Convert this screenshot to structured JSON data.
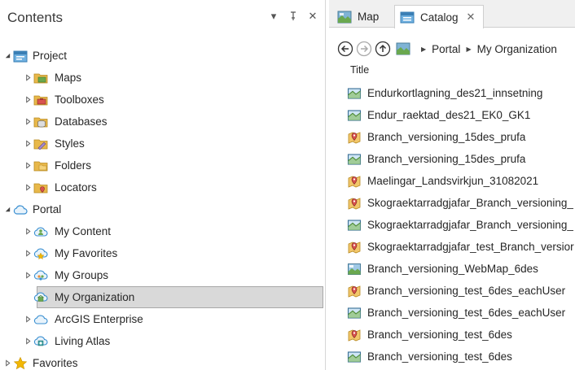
{
  "contents": {
    "title": "Contents",
    "controls": {
      "dropdown": "▾",
      "pin": "⊥",
      "close": "✕"
    },
    "tree": [
      {
        "label": "Project",
        "level": 0,
        "expanded": true,
        "icon": "project-icon"
      },
      {
        "label": "Maps",
        "level": 1,
        "expanded": false,
        "icon": "maps-folder-icon"
      },
      {
        "label": "Toolboxes",
        "level": 1,
        "expanded": false,
        "icon": "toolboxes-folder-icon"
      },
      {
        "label": "Databases",
        "level": 1,
        "expanded": false,
        "icon": "databases-folder-icon"
      },
      {
        "label": "Styles",
        "level": 1,
        "expanded": false,
        "icon": "styles-folder-icon"
      },
      {
        "label": "Folders",
        "level": 1,
        "expanded": false,
        "icon": "folders-folder-icon"
      },
      {
        "label": "Locators",
        "level": 1,
        "expanded": false,
        "icon": "locators-folder-icon"
      },
      {
        "label": "Portal",
        "level": 0,
        "expanded": true,
        "icon": "portal-cloud-icon"
      },
      {
        "label": "My Content",
        "level": 1,
        "expanded": false,
        "icon": "my-content-icon"
      },
      {
        "label": "My Favorites",
        "level": 1,
        "expanded": false,
        "icon": "my-favorites-icon"
      },
      {
        "label": "My Groups",
        "level": 1,
        "expanded": false,
        "icon": "my-groups-icon"
      },
      {
        "label": "My Organization",
        "level": 1,
        "expanded": null,
        "selected": true,
        "icon": "my-organization-icon"
      },
      {
        "label": "ArcGIS Enterprise",
        "level": 1,
        "expanded": false,
        "icon": "arcgis-enterprise-icon"
      },
      {
        "label": "Living Atlas",
        "level": 1,
        "expanded": false,
        "icon": "living-atlas-icon"
      },
      {
        "label": "Favorites",
        "level": 0,
        "expanded": false,
        "icon": "favorites-star-icon"
      }
    ]
  },
  "tabs": [
    {
      "label": "Map",
      "active": false,
      "icon": "map-tab-icon"
    },
    {
      "label": "Catalog",
      "active": true,
      "icon": "catalog-tab-icon",
      "close": "✕"
    }
  ],
  "breadcrumb": [
    "Portal",
    "My Organization"
  ],
  "list": {
    "column_title": "Title",
    "items": [
      {
        "label": "Endurkortlagning_des21_innsetning",
        "icon": "feature-layer-icon"
      },
      {
        "label": "Endur_raektad_des21_EK0_GK1",
        "icon": "feature-layer-icon"
      },
      {
        "label": "Branch_versioning_15des_prufa",
        "icon": "feature-service-icon"
      },
      {
        "label": "Branch_versioning_15des_prufa",
        "icon": "feature-layer-icon"
      },
      {
        "label": "Maelingar_Landsvirkjun_31082021",
        "icon": "feature-service-icon"
      },
      {
        "label": "Skograektarradgjafar_Branch_versioning_",
        "icon": "feature-service-icon"
      },
      {
        "label": "Skograektarradgjafar_Branch_versioning_",
        "icon": "feature-layer-icon"
      },
      {
        "label": "Skograektarradgjafar_test_Branch_versior",
        "icon": "feature-service-icon"
      },
      {
        "label": "Branch_versioning_WebMap_6des",
        "icon": "web-map-icon"
      },
      {
        "label": "Branch_versioning_test_6des_eachUser",
        "icon": "feature-service-icon"
      },
      {
        "label": "Branch_versioning_test_6des_eachUser",
        "icon": "feature-layer-icon"
      },
      {
        "label": "Branch_versioning_test_6des",
        "icon": "feature-service-icon"
      },
      {
        "label": "Branch_versioning_test_6des",
        "icon": "feature-layer-icon"
      }
    ]
  },
  "colors": {
    "selection_bg": "#d9d9d9",
    "tab_strip_bg": "#f0f0f0",
    "portal_blue": "#3a8fd1",
    "folder_yellow": "#e8b84a"
  }
}
